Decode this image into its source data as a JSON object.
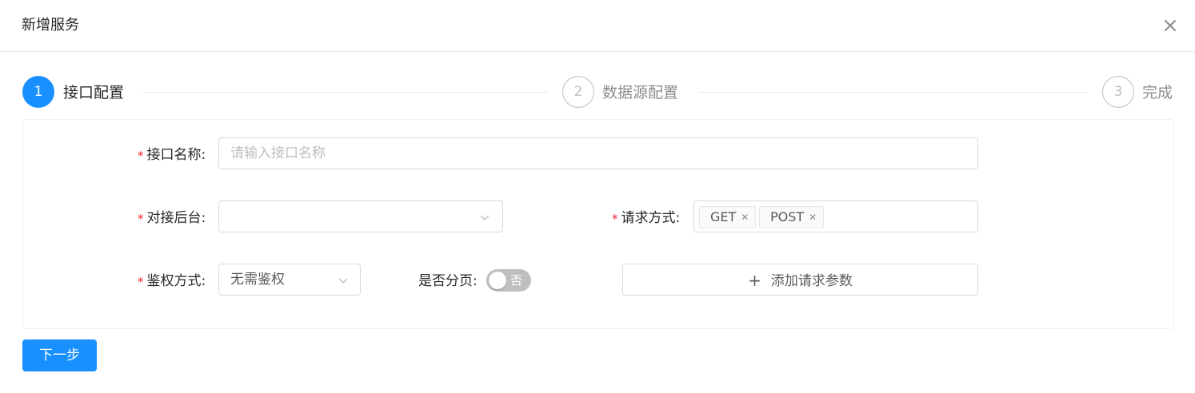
{
  "modal": {
    "title": "新增服务"
  },
  "steps": [
    {
      "number": "1",
      "title": "接口配置",
      "status": "active"
    },
    {
      "number": "2",
      "title": "数据源配置",
      "status": "wait"
    },
    {
      "number": "3",
      "title": "完成",
      "status": "wait"
    }
  ],
  "form": {
    "interface_name": {
      "label": "接口名称:",
      "value": "",
      "placeholder": "请输入接口名称",
      "required": true
    },
    "backend": {
      "label": "对接后台:",
      "value": "",
      "required": true
    },
    "request_method": {
      "label": "请求方式:",
      "tags": [
        "GET",
        "POST"
      ],
      "required": true
    },
    "auth_method": {
      "label": "鉴权方式:",
      "value": "无需鉴权",
      "required": true
    },
    "pagination": {
      "label": "是否分页:",
      "switch_text": "否",
      "checked": false
    },
    "add_param_button": "添加请求参数"
  },
  "footer": {
    "next_button": "下一步"
  },
  "colors": {
    "primary": "#1890ff",
    "required_mark": "#f5222d",
    "border": "#d9d9d9",
    "switch_off": "#bfbfbf"
  },
  "icons": {
    "close": "close-icon",
    "dropdown": "chevron-down-icon",
    "tag_close": "close-icon",
    "add": "plus-icon"
  }
}
